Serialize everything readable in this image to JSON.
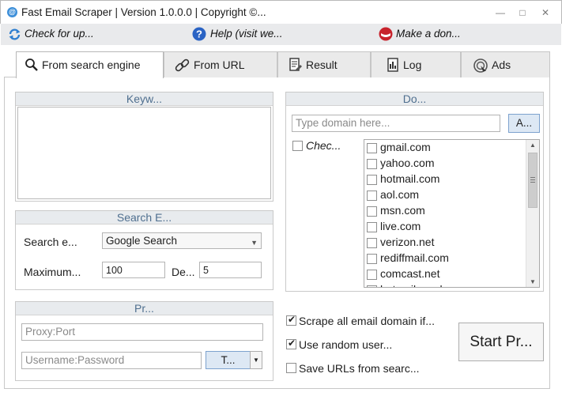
{
  "window": {
    "title": "Fast Email Scraper | Version 1.0.0.0 | Copyright ©...",
    "app_icon_glyph": "@"
  },
  "toolbar": {
    "check_updates": "Check for up...",
    "help": "Help (visit we...",
    "donate": "Make a don..."
  },
  "tabs": [
    {
      "label": "From search engine",
      "icon": "search-icon",
      "active": true
    },
    {
      "label": "From URL",
      "icon": "link-icon",
      "active": false
    },
    {
      "label": "Result",
      "icon": "result-icon",
      "active": false
    },
    {
      "label": "Log",
      "icon": "log-icon",
      "active": false
    },
    {
      "label": "Ads",
      "icon": "ads-icon",
      "active": false
    }
  ],
  "keywords": {
    "header": "Keyw...",
    "value": ""
  },
  "search_engine": {
    "header": "Search E...",
    "engine_label": "Search e...",
    "engine_value": "Google Search",
    "max_label": "Maximum...",
    "max_value": "100",
    "delay_label": "De...",
    "delay_value": "5"
  },
  "proxy": {
    "header": "Pr...",
    "proxy_placeholder": "Proxy:Port",
    "credentials_placeholder": "Username:Password",
    "type_button": "T..."
  },
  "domains": {
    "header": "Do...",
    "input_placeholder": "Type domain here...",
    "add_button": "A...",
    "check_all_label": "Chec...",
    "items": [
      "gmail.com",
      "yahoo.com",
      "hotmail.com",
      "aol.com",
      "msn.com",
      "live.com",
      "verizon.net",
      "rediffmail.com",
      "comcast.net",
      "hotmail.co.uk"
    ]
  },
  "options": {
    "scrape_all": {
      "label": "Scrape all email domain if...",
      "checked": true
    },
    "random_user": {
      "label": "Use random user...",
      "checked": true
    },
    "save_urls": {
      "label": "Save URLs from searc...",
      "checked": false
    }
  },
  "start_button": "Start Pr...",
  "colors": {
    "group_header_bg": "#e8ebee",
    "group_header_text": "#4f6f8f",
    "toolbar_bg": "#e9eaec",
    "accent_blue": "#3d8fd9"
  }
}
